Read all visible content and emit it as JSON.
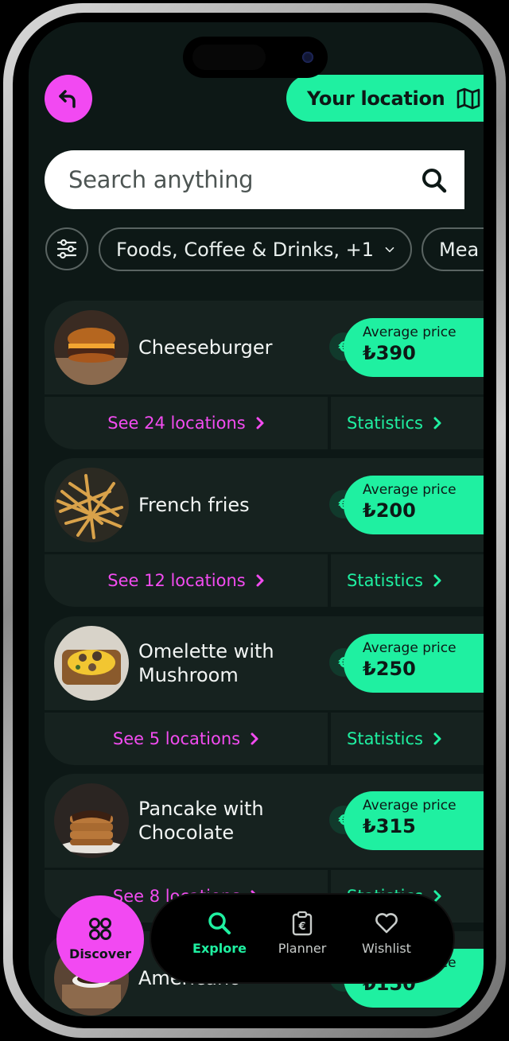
{
  "header": {
    "location_label": "Your location"
  },
  "search": {
    "placeholder": "Search anything"
  },
  "filters": {
    "selected_chip": "Foods, Coffee & Drinks, +1",
    "next_chip": "Mea"
  },
  "items": [
    {
      "name": "Cheeseburger",
      "price_label": "Average price",
      "price": "₺390",
      "locations": "See 24 locations",
      "stats": "Statistics"
    },
    {
      "name": "French fries",
      "price_label": "Average price",
      "price": "₺200",
      "locations": "See 12 locations",
      "stats": "Statistics"
    },
    {
      "name": "Omelette with Mushroom",
      "price_label": "Average price",
      "price": "₺250",
      "locations": "See 5 locations",
      "stats": "Statistics"
    },
    {
      "name": "Pancake with Chocolate",
      "price_label": "Average price",
      "price": "₺315",
      "locations": "See 8 locations",
      "stats": "Statistics"
    },
    {
      "name": "Americano",
      "price_label": "Average price",
      "price": "₺150"
    }
  ],
  "tabbar": {
    "discover": "Discover",
    "explore": "Explore",
    "planner": "Planner",
    "wishlist": "Wishlist"
  },
  "colors": {
    "accent_green": "#1ff0a1",
    "accent_pink": "#f249f2",
    "background": "#0d1816",
    "card": "#16221f"
  }
}
